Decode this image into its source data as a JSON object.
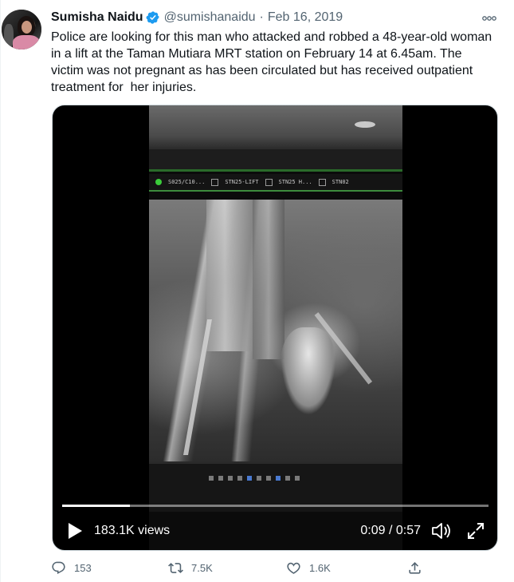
{
  "tweet": {
    "author_name": "Sumisha Naidu",
    "handle": "@sumishanaidu",
    "separator": "·",
    "date": "Feb 16, 2019",
    "text": "Police are looking for this man who attacked and robbed a 48-year-old woman in a lift at the Taman Mutiara MRT station on February 14 at 6.45am. The victim was not pregnant as has been circulated but has received outpatient treatment for  her injuries.",
    "verified": true
  },
  "video": {
    "views": "183.1K views",
    "time": "0:09 / 0:57",
    "progress_fraction": 0.158,
    "camera_labels": [
      "S025/C10...",
      "STN25-LIFT",
      "STN25 H...",
      "STN02"
    ]
  },
  "actions": {
    "replies": "153",
    "retweets": "7.5K",
    "likes": "1.6K"
  },
  "icons": {
    "verified": "verified-badge-icon",
    "more": "more-options-icon",
    "play": "play-icon",
    "volume": "volume-icon",
    "fullscreen": "fullscreen-icon",
    "reply": "reply-icon",
    "retweet": "retweet-icon",
    "like": "like-icon",
    "share": "share-icon"
  },
  "colors": {
    "verified_blue": "#1d9bf0",
    "secondary_text": "#536471",
    "primary_text": "#0f1419"
  }
}
